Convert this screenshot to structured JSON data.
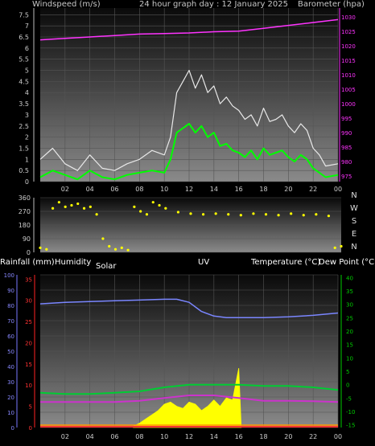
{
  "header": {
    "left_label": "Windspeed (m/s)",
    "center_label": "24 hour graph day : 12 January 2025",
    "right_label": "Barometer (hpa)"
  },
  "bottom_header": {
    "rainfall_label": "Rainfall (mm)",
    "humidity_label": "Humidity",
    "solar_label": "Solar",
    "uv_label": "UV",
    "temperature_label": "Temperature (°C)",
    "dewpoint_label": "Dew Point (°C)"
  },
  "colors": {
    "wind_gust": "#e8e8e8",
    "wind_avg": "#00ff00",
    "barometer": "#ff33ff",
    "wind_dir": "#ffff00",
    "humidity": "#7a86ff",
    "temperature": "#00cc33",
    "dewpoint": "#cc33cc",
    "solar": "#ffff00",
    "rain_axis": "#7777ff",
    "temp_axis": "#00cc00",
    "uv_axis": "#ff2222"
  },
  "chart_data": [
    {
      "id": "wind",
      "type": "line",
      "x_ticks": [
        "02",
        "04",
        "06",
        "08",
        "10",
        "12",
        "14",
        "16",
        "18",
        "20",
        "22",
        "00"
      ],
      "y_ticks_left": [
        "0",
        "0.5",
        "1",
        "1.5",
        "2",
        "2.5",
        "3",
        "3.5",
        "4",
        "4.5",
        "5",
        "5.5",
        "6",
        "6.5",
        "7",
        "7.5"
      ],
      "y_ticks_right": [
        "975",
        "980",
        "985",
        "990",
        "995",
        "1000",
        "1005",
        "1010",
        "1015",
        "1020",
        "1025",
        "1030"
      ],
      "ylim_left": [
        0,
        7.8
      ],
      "ylim_right": [
        973,
        1033
      ],
      "series": [
        {
          "key": "gust",
          "x": [
            0,
            1,
            2,
            3,
            4,
            5,
            6,
            7,
            8,
            9,
            10,
            10.5,
            11,
            11.5,
            12,
            12.5,
            13,
            13.5,
            14,
            14.5,
            15,
            15.5,
            16,
            16.5,
            17,
            17.5,
            18,
            18.5,
            19,
            19.5,
            20,
            20.5,
            21,
            21.5,
            22,
            22.5,
            23,
            24
          ],
          "y": [
            1,
            1.5,
            0.8,
            0.5,
            1.2,
            0.6,
            0.5,
            0.8,
            1.0,
            1.4,
            1.2,
            2.0,
            4.0,
            4.5,
            5.0,
            4.2,
            4.8,
            4.0,
            4.3,
            3.5,
            3.8,
            3.4,
            3.2,
            2.8,
            3.0,
            2.5,
            3.3,
            2.7,
            2.8,
            3.0,
            2.5,
            2.2,
            2.6,
            2.3,
            1.5,
            1.2,
            0.7,
            0.8
          ]
        },
        {
          "key": "avg",
          "x": [
            0,
            1,
            2,
            3,
            4,
            5,
            6,
            7,
            8,
            9,
            10,
            10.5,
            11,
            11.5,
            12,
            12.5,
            13,
            13.5,
            14,
            14.5,
            15,
            15.5,
            16,
            16.5,
            17,
            17.5,
            18,
            18.5,
            19,
            19.5,
            20,
            20.5,
            21,
            21.5,
            22,
            22.5,
            23,
            24
          ],
          "y": [
            0.2,
            0.5,
            0.3,
            0.1,
            0.5,
            0.2,
            0.1,
            0.3,
            0.4,
            0.5,
            0.4,
            1.0,
            2.2,
            2.4,
            2.6,
            2.2,
            2.5,
            2.0,
            2.2,
            1.6,
            1.7,
            1.4,
            1.3,
            1.1,
            1.4,
            1.0,
            1.5,
            1.2,
            1.3,
            1.4,
            1.1,
            0.9,
            1.2,
            1.0,
            0.6,
            0.4,
            0.2,
            0.3
          ]
        },
        {
          "key": "barometer",
          "x": [
            0,
            2,
            4,
            6,
            8,
            10,
            12,
            14,
            16,
            18,
            20,
            22,
            24
          ],
          "y": [
            1022,
            1022.5,
            1023,
            1023.5,
            1024,
            1024.2,
            1024.4,
            1024.8,
            1025.0,
            1026.0,
            1027.0,
            1028.0,
            1029.0
          ]
        }
      ]
    },
    {
      "id": "wind_direction",
      "type": "scatter",
      "y_ticks_left": [
        "0",
        "90",
        "180",
        "270",
        "360"
      ],
      "compass_labels": [
        "N",
        "W",
        "S",
        "E",
        "N"
      ],
      "ylim": [
        0,
        360
      ],
      "x": [
        0,
        0.5,
        1,
        1.5,
        2,
        2.5,
        3,
        3.5,
        4,
        4.5,
        5,
        5.5,
        6,
        6.5,
        7,
        7.5,
        8,
        8.5,
        9,
        9.5,
        10,
        11,
        12,
        13,
        14,
        15,
        16,
        17,
        18,
        19,
        20,
        21,
        22,
        23,
        23.5,
        24
      ],
      "y": [
        30,
        20,
        290,
        330,
        300,
        310,
        320,
        290,
        300,
        250,
        90,
        40,
        20,
        30,
        15,
        300,
        270,
        250,
        330,
        310,
        290,
        265,
        255,
        250,
        255,
        250,
        245,
        255,
        250,
        245,
        255,
        245,
        250,
        240,
        30,
        40
      ]
    },
    {
      "id": "weather",
      "type": "line",
      "x_ticks": [
        "02",
        "04",
        "06",
        "08",
        "10",
        "12",
        "14",
        "16",
        "18",
        "20",
        "22",
        "00"
      ],
      "y_ticks_rain": [
        "0",
        "10",
        "20",
        "30",
        "40",
        "50",
        "60",
        "70",
        "80",
        "90",
        "100"
      ],
      "y_ticks_uv": [
        "0",
        "5",
        "10",
        "15",
        "20",
        "25",
        "30",
        "35"
      ],
      "y_ticks_temp": [
        "-15",
        "-10",
        "-5",
        "0",
        "5",
        "10",
        "15",
        "20",
        "25",
        "30",
        "35",
        "40"
      ],
      "humidity_lim": [
        0,
        100
      ],
      "temp_lim": [
        -16,
        41
      ],
      "series": [
        {
          "key": "humidity",
          "x": [
            0,
            2,
            4,
            6,
            8,
            10,
            11,
            12,
            13,
            14,
            15,
            16,
            18,
            20,
            22,
            24
          ],
          "y": [
            81,
            82,
            82.5,
            83,
            83.5,
            84,
            84,
            82,
            76,
            73,
            72,
            72,
            72,
            72.5,
            73.5,
            75
          ]
        },
        {
          "key": "temperature",
          "x": [
            0,
            2,
            4,
            6,
            8,
            10,
            12,
            14,
            16,
            18,
            20,
            22,
            24
          ],
          "y": [
            -3,
            -3.5,
            -3.5,
            -3,
            -2.5,
            -1,
            0,
            0,
            0,
            -0.5,
            -0.5,
            -1,
            -2
          ]
        },
        {
          "key": "dewpoint",
          "x": [
            0,
            2,
            4,
            6,
            8,
            10,
            12,
            14,
            16,
            18,
            20,
            22,
            24
          ],
          "y": [
            -6.5,
            -6.5,
            -6.5,
            -6.5,
            -6,
            -5,
            -4,
            -4,
            -5,
            -6,
            -6,
            -6.2,
            -6.5
          ]
        },
        {
          "key": "solar",
          "x": [
            7.5,
            8,
            8.5,
            9,
            9.5,
            10,
            10.5,
            11,
            11.5,
            12,
            12.5,
            13,
            13.5,
            14,
            14.5,
            15,
            15.5,
            16,
            16.2
          ],
          "y": [
            0.3,
            1.0,
            2.0,
            3.0,
            4.0,
            5.5,
            6.0,
            5.0,
            4.5,
            6.0,
            5.5,
            4.0,
            5.0,
            6.5,
            5.0,
            7.0,
            6.5,
            14,
            0
          ]
        }
      ]
    }
  ]
}
